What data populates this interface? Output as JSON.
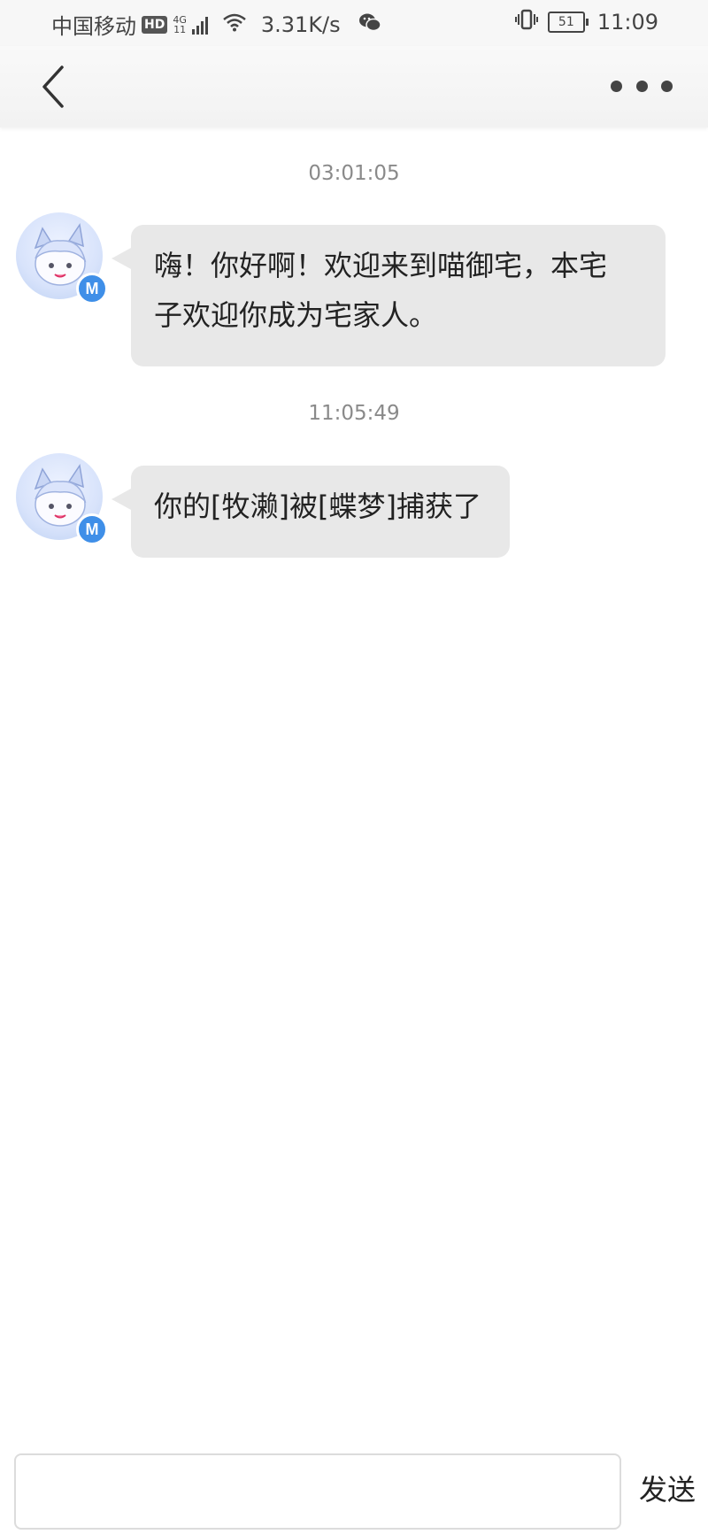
{
  "status_bar": {
    "carrier": "中国移动",
    "hd_badge": "HD",
    "network_type": "4G",
    "network_sub": "11",
    "speed": "3.31K/s",
    "battery_level": "51",
    "time": "11:09",
    "icons": [
      "hd-icon",
      "signal-icon",
      "wifi-icon",
      "wechat-icon",
      "vibrate-icon",
      "battery-icon"
    ]
  },
  "nav": {
    "back_icon": "chevron-left-icon",
    "more_icon": "more-dots-icon"
  },
  "messages": [
    {
      "timestamp": "03:01:05",
      "text": "嗨！你好啊！欢迎来到喵御宅，本宅子欢迎你成为宅家人。",
      "line1": "嗨！你好啊！欢迎来到喵御宅，本宅",
      "line2": "子欢迎你成为宅家人。",
      "avatar_badge": "M"
    },
    {
      "timestamp": "11:05:49",
      "text": "你的[牧濑]被[蝶梦]捕获了",
      "avatar_badge": "M"
    }
  ],
  "input": {
    "value": "",
    "placeholder": ""
  },
  "send_label": "发送",
  "colors": {
    "bubble": "#e8e8e8",
    "timestamp": "#8a8a8a",
    "badge": "#3f8fe8"
  }
}
